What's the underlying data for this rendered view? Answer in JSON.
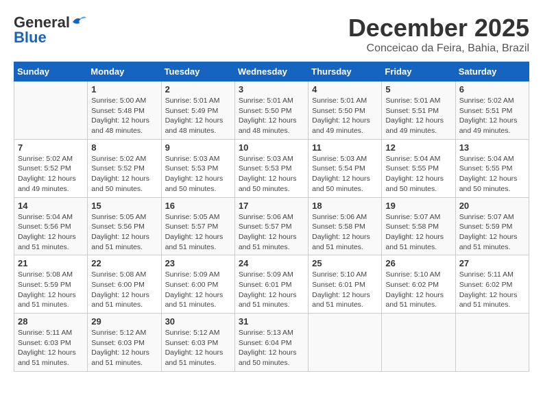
{
  "header": {
    "logo_general": "General",
    "logo_blue": "Blue",
    "title": "December 2025",
    "subtitle": "Conceicao da Feira, Bahia, Brazil"
  },
  "days_of_week": [
    "Sunday",
    "Monday",
    "Tuesday",
    "Wednesday",
    "Thursday",
    "Friday",
    "Saturday"
  ],
  "weeks": [
    [
      {
        "day": "",
        "info": ""
      },
      {
        "day": "1",
        "info": "Sunrise: 5:00 AM\nSunset: 5:48 PM\nDaylight: 12 hours\nand 48 minutes."
      },
      {
        "day": "2",
        "info": "Sunrise: 5:01 AM\nSunset: 5:49 PM\nDaylight: 12 hours\nand 48 minutes."
      },
      {
        "day": "3",
        "info": "Sunrise: 5:01 AM\nSunset: 5:50 PM\nDaylight: 12 hours\nand 48 minutes."
      },
      {
        "day": "4",
        "info": "Sunrise: 5:01 AM\nSunset: 5:50 PM\nDaylight: 12 hours\nand 49 minutes."
      },
      {
        "day": "5",
        "info": "Sunrise: 5:01 AM\nSunset: 5:51 PM\nDaylight: 12 hours\nand 49 minutes."
      },
      {
        "day": "6",
        "info": "Sunrise: 5:02 AM\nSunset: 5:51 PM\nDaylight: 12 hours\nand 49 minutes."
      }
    ],
    [
      {
        "day": "7",
        "info": "Sunrise: 5:02 AM\nSunset: 5:52 PM\nDaylight: 12 hours\nand 49 minutes."
      },
      {
        "day": "8",
        "info": "Sunrise: 5:02 AM\nSunset: 5:52 PM\nDaylight: 12 hours\nand 50 minutes."
      },
      {
        "day": "9",
        "info": "Sunrise: 5:03 AM\nSunset: 5:53 PM\nDaylight: 12 hours\nand 50 minutes."
      },
      {
        "day": "10",
        "info": "Sunrise: 5:03 AM\nSunset: 5:53 PM\nDaylight: 12 hours\nand 50 minutes."
      },
      {
        "day": "11",
        "info": "Sunrise: 5:03 AM\nSunset: 5:54 PM\nDaylight: 12 hours\nand 50 minutes."
      },
      {
        "day": "12",
        "info": "Sunrise: 5:04 AM\nSunset: 5:55 PM\nDaylight: 12 hours\nand 50 minutes."
      },
      {
        "day": "13",
        "info": "Sunrise: 5:04 AM\nSunset: 5:55 PM\nDaylight: 12 hours\nand 50 minutes."
      }
    ],
    [
      {
        "day": "14",
        "info": "Sunrise: 5:04 AM\nSunset: 5:56 PM\nDaylight: 12 hours\nand 51 minutes."
      },
      {
        "day": "15",
        "info": "Sunrise: 5:05 AM\nSunset: 5:56 PM\nDaylight: 12 hours\nand 51 minutes."
      },
      {
        "day": "16",
        "info": "Sunrise: 5:05 AM\nSunset: 5:57 PM\nDaylight: 12 hours\nand 51 minutes."
      },
      {
        "day": "17",
        "info": "Sunrise: 5:06 AM\nSunset: 5:57 PM\nDaylight: 12 hours\nand 51 minutes."
      },
      {
        "day": "18",
        "info": "Sunrise: 5:06 AM\nSunset: 5:58 PM\nDaylight: 12 hours\nand 51 minutes."
      },
      {
        "day": "19",
        "info": "Sunrise: 5:07 AM\nSunset: 5:58 PM\nDaylight: 12 hours\nand 51 minutes."
      },
      {
        "day": "20",
        "info": "Sunrise: 5:07 AM\nSunset: 5:59 PM\nDaylight: 12 hours\nand 51 minutes."
      }
    ],
    [
      {
        "day": "21",
        "info": "Sunrise: 5:08 AM\nSunset: 5:59 PM\nDaylight: 12 hours\nand 51 minutes."
      },
      {
        "day": "22",
        "info": "Sunrise: 5:08 AM\nSunset: 6:00 PM\nDaylight: 12 hours\nand 51 minutes."
      },
      {
        "day": "23",
        "info": "Sunrise: 5:09 AM\nSunset: 6:00 PM\nDaylight: 12 hours\nand 51 minutes."
      },
      {
        "day": "24",
        "info": "Sunrise: 5:09 AM\nSunset: 6:01 PM\nDaylight: 12 hours\nand 51 minutes."
      },
      {
        "day": "25",
        "info": "Sunrise: 5:10 AM\nSunset: 6:01 PM\nDaylight: 12 hours\nand 51 minutes."
      },
      {
        "day": "26",
        "info": "Sunrise: 5:10 AM\nSunset: 6:02 PM\nDaylight: 12 hours\nand 51 minutes."
      },
      {
        "day": "27",
        "info": "Sunrise: 5:11 AM\nSunset: 6:02 PM\nDaylight: 12 hours\nand 51 minutes."
      }
    ],
    [
      {
        "day": "28",
        "info": "Sunrise: 5:11 AM\nSunset: 6:03 PM\nDaylight: 12 hours\nand 51 minutes."
      },
      {
        "day": "29",
        "info": "Sunrise: 5:12 AM\nSunset: 6:03 PM\nDaylight: 12 hours\nand 51 minutes."
      },
      {
        "day": "30",
        "info": "Sunrise: 5:12 AM\nSunset: 6:03 PM\nDaylight: 12 hours\nand 51 minutes."
      },
      {
        "day": "31",
        "info": "Sunrise: 5:13 AM\nSunset: 6:04 PM\nDaylight: 12 hours\nand 50 minutes."
      },
      {
        "day": "",
        "info": ""
      },
      {
        "day": "",
        "info": ""
      },
      {
        "day": "",
        "info": ""
      }
    ]
  ]
}
